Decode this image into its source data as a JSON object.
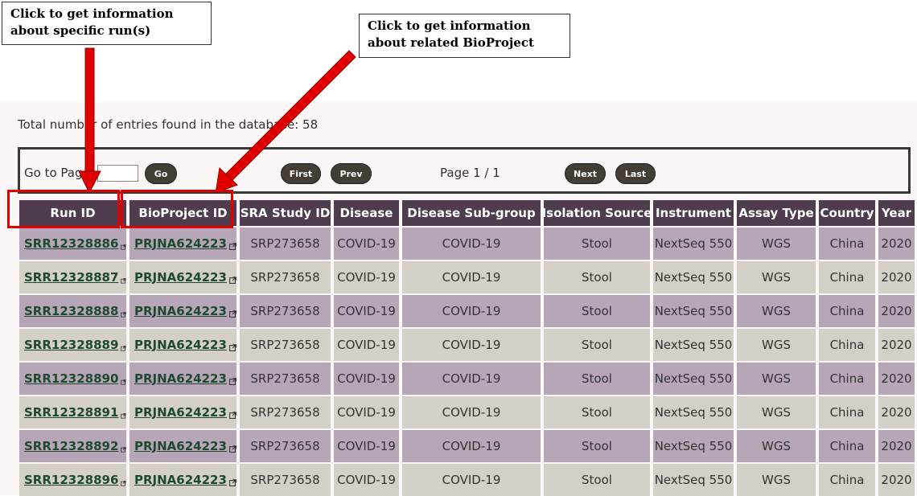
{
  "summary": {
    "total_text": "Total number of entries found in the database: 58"
  },
  "pager": {
    "goto_label": "Go to Page",
    "goto_value": "",
    "go_label": "Go",
    "first_label": "First",
    "prev_label": "Prev",
    "page_status": "Page 1 / 1",
    "next_label": "Next",
    "last_label": "Last"
  },
  "table": {
    "headers": [
      "Run ID",
      "BioProject ID",
      "SRA Study ID",
      "Disease",
      "Disease Sub-group",
      "Isolation Source",
      "Instrument",
      "Assay Type",
      "Country",
      "Year"
    ],
    "rows": [
      [
        "SRR12328886",
        "PRJNA624223",
        "SRP273658",
        "COVID-19",
        "COVID-19",
        "Stool",
        "NextSeq 550",
        "WGS",
        "China",
        "2020"
      ],
      [
        "SRR12328887",
        "PRJNA624223",
        "SRP273658",
        "COVID-19",
        "COVID-19",
        "Stool",
        "NextSeq 550",
        "WGS",
        "China",
        "2020"
      ],
      [
        "SRR12328888",
        "PRJNA624223",
        "SRP273658",
        "COVID-19",
        "COVID-19",
        "Stool",
        "NextSeq 550",
        "WGS",
        "China",
        "2020"
      ],
      [
        "SRR12328889",
        "PRJNA624223",
        "SRP273658",
        "COVID-19",
        "COVID-19",
        "Stool",
        "NextSeq 550",
        "WGS",
        "China",
        "2020"
      ],
      [
        "SRR12328890",
        "PRJNA624223",
        "SRP273658",
        "COVID-19",
        "COVID-19",
        "Stool",
        "NextSeq 550",
        "WGS",
        "China",
        "2020"
      ],
      [
        "SRR12328891",
        "PRJNA624223",
        "SRP273658",
        "COVID-19",
        "COVID-19",
        "Stool",
        "NextSeq 550",
        "WGS",
        "China",
        "2020"
      ],
      [
        "SRR12328892",
        "PRJNA624223",
        "SRP273658",
        "COVID-19",
        "COVID-19",
        "Stool",
        "NextSeq 550",
        "WGS",
        "China",
        "2020"
      ],
      [
        "SRR12328896",
        "PRJNA624223",
        "SRP273658",
        "COVID-19",
        "COVID-19",
        "Stool",
        "NextSeq 550",
        "WGS",
        "China",
        "2020"
      ]
    ],
    "link_icon": "external-link-icon"
  },
  "annotations": {
    "run_callout": "Click to get information about specific run(s)",
    "bioproject_callout": "Click to get information about related BioProject"
  },
  "colors": {
    "header_bg": "#4f3d4f",
    "row_odd_bg": "#b7a6b8",
    "row_even_bg": "#d4d0c8",
    "link_color": "#1d4a2e",
    "annotation_red": "#e00000",
    "button_bg": "#433d36"
  }
}
